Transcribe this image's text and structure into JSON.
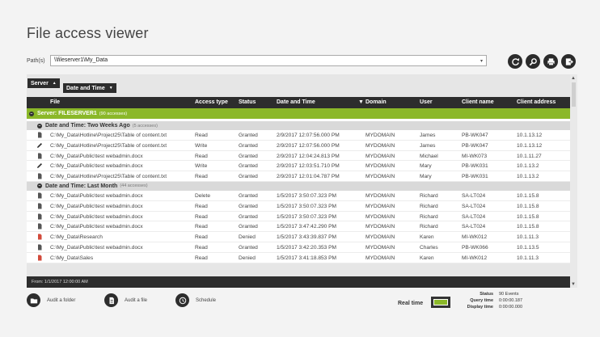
{
  "title": "File access viewer",
  "path": {
    "label": "Path(s)",
    "value": "\\\\fileserver1\\My_Data",
    "dropdown_glyph": "▾"
  },
  "toolbar": [
    {
      "name": "refresh-icon"
    },
    {
      "name": "search-icon"
    },
    {
      "name": "print-icon"
    },
    {
      "name": "export-icon"
    }
  ],
  "grouping": {
    "server_chip": "Server",
    "date_chip": "Date and Time"
  },
  "columns": {
    "file": "File",
    "access_type": "Access type",
    "status": "Status",
    "date": "Date and Time",
    "domain": "Domain",
    "user": "User",
    "client_name": "Client name",
    "client_address": "Client address"
  },
  "server_group": {
    "label": "Server: FILESERVER1",
    "count": "(90 accesses)"
  },
  "groups": [
    {
      "label": "Date and Time: Two Weeks Ago",
      "count": "(5 accesses)",
      "rows": [
        {
          "icon": "doc",
          "file": "C:\\My_Data\\Hotline\\Project25\\Table of content.txt",
          "access": "Read",
          "status": "Granted",
          "date": "2/9/2017 12:07:56.000 PM",
          "domain": "MYDOMAIN",
          "user": "James",
          "client": "PB-WK047",
          "addr": "10.1.13.12"
        },
        {
          "icon": "pen",
          "file": "C:\\My_Data\\Hotline\\Project25\\Table of content.txt",
          "access": "Write",
          "status": "Granted",
          "date": "2/9/2017 12:07:56.000 PM",
          "domain": "MYDOMAIN",
          "user": "James",
          "client": "PB-WK047",
          "addr": "10.1.13.12"
        },
        {
          "icon": "doc",
          "file": "C:\\My_Data\\Public\\test webadmin.docx",
          "access": "Read",
          "status": "Granted",
          "date": "2/9/2017 12:04:24.813 PM",
          "domain": "MYDOMAIN",
          "user": "Michael",
          "client": "MI-WK073",
          "addr": "10.1.11.27"
        },
        {
          "icon": "pen",
          "file": "C:\\My_Data\\Public\\test webadmin.docx",
          "access": "Write",
          "status": "Granted",
          "date": "2/9/2017 12:03:51.710 PM",
          "domain": "MYDOMAIN",
          "user": "Mary",
          "client": "PB-WK031",
          "addr": "10.1.13.2"
        },
        {
          "icon": "doc",
          "file": "C:\\My_Data\\Hotline\\Project25\\Table of content.txt",
          "access": "Read",
          "status": "Granted",
          "date": "2/9/2017 12:01:04.787 PM",
          "domain": "MYDOMAIN",
          "user": "Mary",
          "client": "PB-WK031",
          "addr": "10.1.13.2"
        }
      ]
    },
    {
      "label": "Date and Time: Last Month",
      "count": "(44 accesses)",
      "rows": [
        {
          "icon": "doc",
          "file": "C:\\My_Data\\Public\\test webadmin.docx",
          "access": "Delete",
          "status": "Granted",
          "date": "1/5/2017 3:50:07.323 PM",
          "domain": "MYDOMAIN",
          "user": "Richard",
          "client": "SA-LT024",
          "addr": "10.1.15.8"
        },
        {
          "icon": "doc",
          "file": "C:\\My_Data\\Public\\test webadmin.docx",
          "access": "Read",
          "status": "Granted",
          "date": "1/5/2017 3:50:07.323 PM",
          "domain": "MYDOMAIN",
          "user": "Richard",
          "client": "SA-LT024",
          "addr": "10.1.15.8"
        },
        {
          "icon": "doc",
          "file": "C:\\My_Data\\Public\\test webadmin.docx",
          "access": "Read",
          "status": "Granted",
          "date": "1/5/2017 3:50:07.323 PM",
          "domain": "MYDOMAIN",
          "user": "Richard",
          "client": "SA-LT024",
          "addr": "10.1.15.8"
        },
        {
          "icon": "doc",
          "file": "C:\\My_Data\\Public\\test webadmin.docx",
          "access": "Read",
          "status": "Granted",
          "date": "1/5/2017 3:47:42.290 PM",
          "domain": "MYDOMAIN",
          "user": "Richard",
          "client": "SA-LT024",
          "addr": "10.1.15.8"
        },
        {
          "icon": "red",
          "file": "C:\\My_Data\\Research",
          "access": "Read",
          "status": "Denied",
          "date": "1/5/2017 3:43:39.837 PM",
          "domain": "MYDOMAIN",
          "user": "Karen",
          "client": "MI-WK012",
          "addr": "10.1.11.3"
        },
        {
          "icon": "doc",
          "file": "C:\\My_Data\\Public\\test webadmin.docx",
          "access": "Read",
          "status": "Granted",
          "date": "1/5/2017 3:42:20.353 PM",
          "domain": "MYDOMAIN",
          "user": "Charles",
          "client": "PB-WK066",
          "addr": "10.1.13.5"
        },
        {
          "icon": "red",
          "file": "C:\\My_Data\\Sales",
          "access": "Read",
          "status": "Denied",
          "date": "1/5/2017 3:41:18.853 PM",
          "domain": "MYDOMAIN",
          "user": "Karen",
          "client": "MI-WK012",
          "addr": "10.1.11.3"
        }
      ]
    }
  ],
  "from_bar": "From: 1/1/2017 12:00:00 AM",
  "actions": [
    {
      "name": "audit-folder-button",
      "icon": "folder-icon",
      "label": "Audit a folder"
    },
    {
      "name": "audit-file-button",
      "icon": "file-icon",
      "label": "Audit a file"
    },
    {
      "name": "schedule-button",
      "icon": "clock-icon",
      "label": "Schedule"
    }
  ],
  "realtime": {
    "label": "Real time"
  },
  "stats": {
    "status_label": "Status",
    "status_value": "90 Events",
    "query_label": "Query time",
    "query_value": "0:00:00.187",
    "display_label": "Display time",
    "display_value": "0:00:00.000"
  },
  "colors": {
    "accent": "#8bb829",
    "dark": "#2d2d2d",
    "denied": "#d24a3b"
  }
}
